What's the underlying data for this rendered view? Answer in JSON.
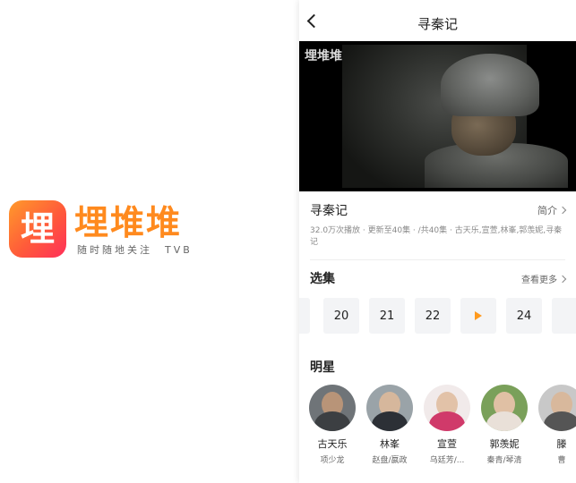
{
  "promo": {
    "icon_glyph": "埋",
    "brand_name": "埋堆堆",
    "slogan": "随时随地关注　TVB",
    "gradient": [
      "#ff9a2b",
      "#ff2f5a"
    ],
    "brand_color": "#ff8a1e"
  },
  "nav": {
    "title": "寻秦记",
    "back_icon": "chevron-left-icon"
  },
  "video": {
    "watermark": "埋堆堆"
  },
  "info": {
    "title": "寻秦记",
    "intro_label": "简介",
    "description": "32.0万次播放 · 更新至40集 · /共40集 · 古天乐,宣萱,林峯,郭羡妮,寻秦记"
  },
  "episodes": {
    "title": "选集",
    "more_label": "查看更多",
    "items": [
      "",
      "20",
      "21",
      "22",
      "",
      "24",
      ""
    ],
    "playing_index": 4,
    "accent": "#ff9a1e"
  },
  "stars": {
    "title": "明星",
    "people": [
      {
        "name": "古天乐",
        "role": "项少龙"
      },
      {
        "name": "林峯",
        "role": "赵盘/嬴政"
      },
      {
        "name": "宣萱",
        "role": "乌廷芳/..."
      },
      {
        "name": "郭羡妮",
        "role": "秦青/琴清"
      },
      {
        "name": "滕",
        "role": "曹"
      }
    ]
  }
}
